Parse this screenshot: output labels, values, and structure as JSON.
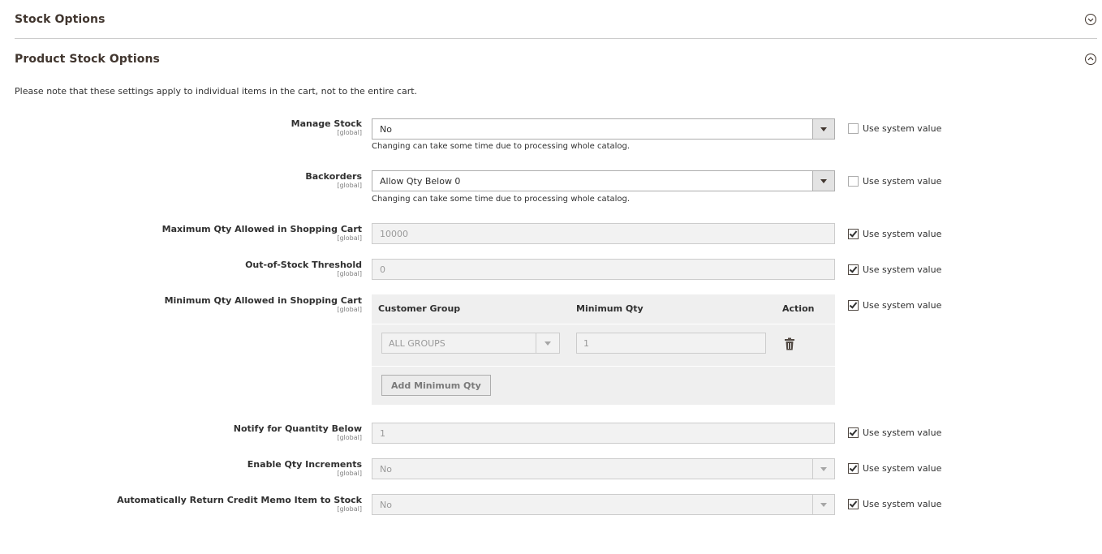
{
  "sections": {
    "stock_options": "Stock Options",
    "product_stock_options": "Product Stock Options"
  },
  "note": "Please note that these settings apply to individual items in the cart, not to the entire cart.",
  "scope_label": "[global]",
  "use_system_value": "Use system value",
  "help_catalog": "Changing can take some time due to processing whole catalog.",
  "fields": {
    "manage_stock": {
      "label": "Manage Stock",
      "value": "No",
      "use_system": false
    },
    "backorders": {
      "label": "Backorders",
      "value": "Allow Qty Below 0",
      "use_system": false
    },
    "max_qty": {
      "label": "Maximum Qty Allowed in Shopping Cart",
      "value": "10000",
      "use_system": true
    },
    "oos_threshold": {
      "label": "Out-of-Stock Threshold",
      "value": "0",
      "use_system": true
    },
    "min_qty": {
      "label": "Minimum Qty Allowed in Shopping Cart",
      "use_system": true,
      "columns": [
        "Customer Group",
        "Minimum Qty",
        "Action"
      ],
      "rows": [
        {
          "group": "ALL GROUPS",
          "qty": "1"
        }
      ],
      "add_button": "Add Minimum Qty"
    },
    "notify_qty": {
      "label": "Notify for Quantity Below",
      "value": "1",
      "use_system": true
    },
    "qty_increments": {
      "label": "Enable Qty Increments",
      "value": "No",
      "use_system": true
    },
    "credit_memo": {
      "label": "Automatically Return Credit Memo Item to Stock",
      "value": "No",
      "use_system": true
    }
  },
  "icons": {
    "collapsed": "chevron-down-circle-icon",
    "expanded": "chevron-up-circle-icon",
    "dropdown": "triangle-down-icon",
    "delete": "trash-icon"
  },
  "colors": {
    "border": "#adadad",
    "disabled_bg": "#f2f2f2",
    "grid_bg": "#efefef",
    "heading": "#41362f"
  }
}
